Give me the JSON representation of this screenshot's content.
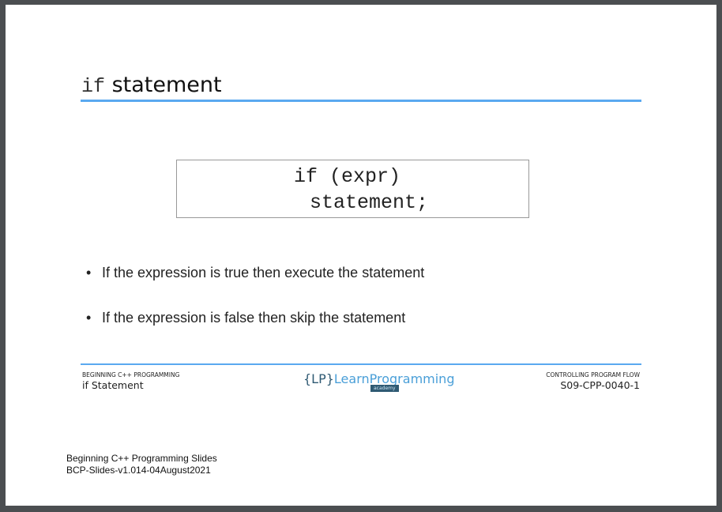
{
  "slide": {
    "title_code": "if",
    "title_text": "statement",
    "code_lines": [
      "if (expr)",
      "statement;"
    ],
    "bullets": [
      "If the expression is true then execute the statement",
      "If the expression is false then skip the statement"
    ],
    "footer": {
      "course": "BEGINNING C++ PROGRAMMING",
      "topic": "if Statement",
      "section": "CONTROLLING PROGRAM FLOW",
      "code": "S09-CPP-0040-1",
      "logo": {
        "brace_text": "{LP}",
        "name": "LearnProgramming",
        "sub": "academy"
      }
    }
  },
  "notes": [
    "Beginning C++ Programming Slides",
    "BCP-Slides-v1.014-04August2021"
  ],
  "colors": {
    "accent": "#5aa9f0",
    "frame": "#4b4e51"
  }
}
